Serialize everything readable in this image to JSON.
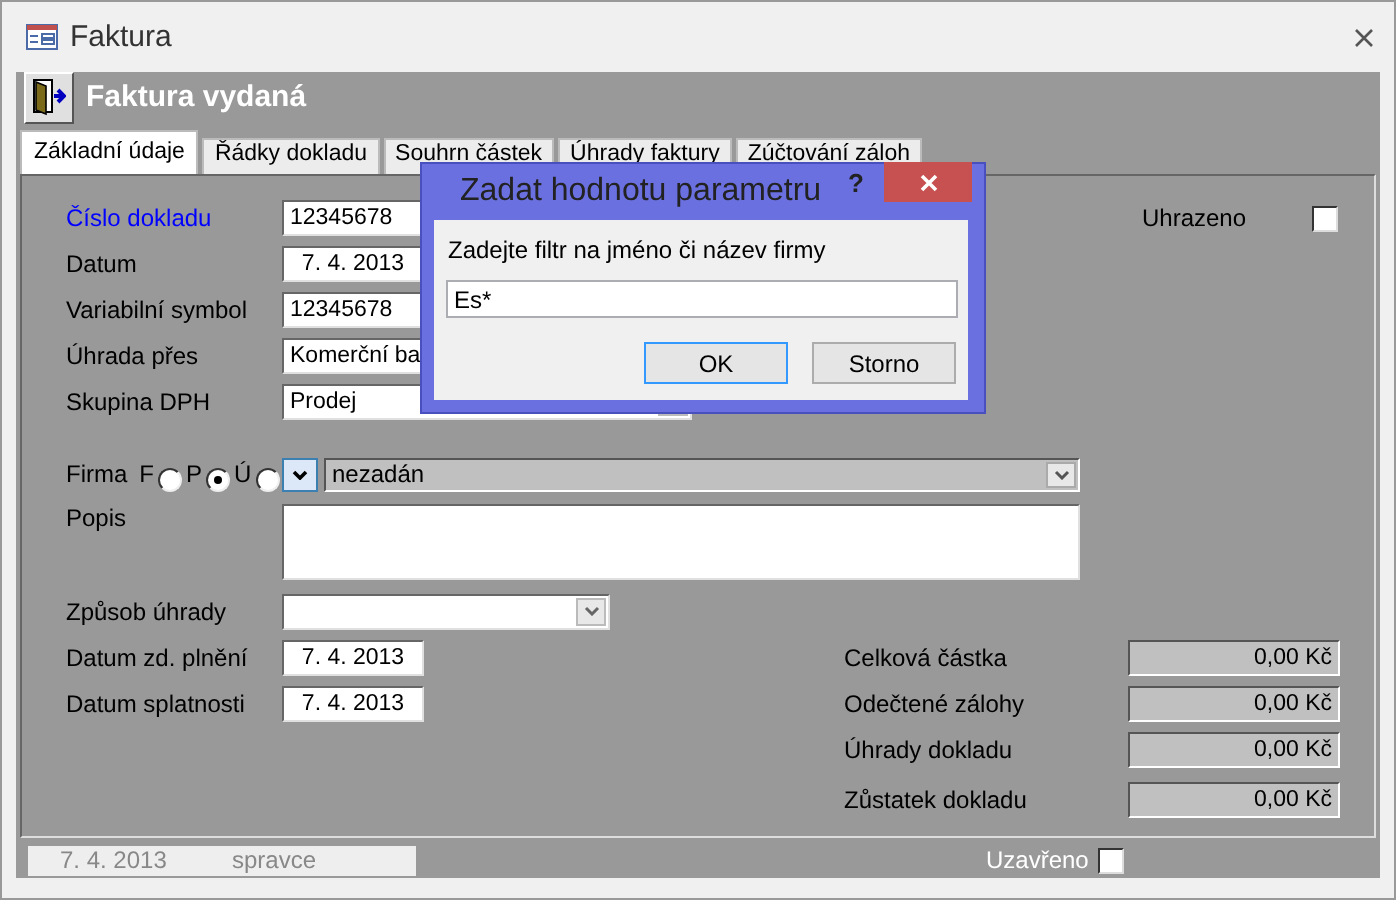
{
  "window": {
    "title": "Faktura"
  },
  "header": {
    "title": "Faktura vydaná"
  },
  "tabs": [
    {
      "label": "Základní údaje",
      "selected": true
    },
    {
      "label": "Řádky dokladu",
      "selected": false
    },
    {
      "label": "Souhrn částek",
      "selected": false
    },
    {
      "label": "Úhrady faktury",
      "selected": false
    },
    {
      "label": "Zúčtování záloh",
      "selected": false
    }
  ],
  "fields": [
    {
      "label": "Číslo dokladu",
      "kind": "text",
      "value": "12345678",
      "highlighted": true
    },
    {
      "label": "Datum",
      "kind": "date",
      "value": "7. 4. 2013",
      "highlighted": false
    },
    {
      "label": "Variabilní symbol",
      "kind": "text",
      "value": "12345678",
      "highlighted": false
    },
    {
      "label": "Úhrada přes",
      "kind": "combo",
      "value": "Komerční ba",
      "highlighted": false
    },
    {
      "label": "Skupina DPH",
      "kind": "combo",
      "value": "Prodej",
      "highlighted": false
    }
  ],
  "paid": {
    "label": "Uhrazeno",
    "checked": false
  },
  "firm": {
    "label": "Firma",
    "options": [
      {
        "label": "F",
        "selected": false
      },
      {
        "label": "P",
        "selected": true
      },
      {
        "label": "Ú",
        "selected": false
      }
    ],
    "value": "nezadán"
  },
  "description": {
    "label": "Popis"
  },
  "lower_fields": [
    {
      "label": "Způsob úhrady",
      "kind": "combo"
    },
    {
      "label": "Datum zd. plnění",
      "kind": "date",
      "value": "7. 4. 2013"
    },
    {
      "label": "Datum splatnosti",
      "kind": "date",
      "value": "7. 4. 2013"
    }
  ],
  "totals": [
    {
      "label": "Celková částka",
      "value": "0,00 Kč"
    },
    {
      "label": "Odečtené zálohy",
      "value": "0,00 Kč"
    },
    {
      "label": "Úhrady dokladu",
      "value": "0,00 Kč"
    },
    {
      "label": "Zůstatek dokladu",
      "value": "0,00 Kč"
    }
  ],
  "status_bar": {
    "date": "7. 4. 2013",
    "user": "spravce",
    "closed": {
      "label": "Uzavřeno",
      "checked": false
    }
  },
  "dialog": {
    "title": "Zadat hodnotu parametru",
    "help": "?",
    "prompt": "Zadejte filtr na jméno či název firmy",
    "value": "Es*",
    "buttons": [
      {
        "label": "OK",
        "default": true
      },
      {
        "label": "Storno",
        "default": false
      }
    ]
  }
}
